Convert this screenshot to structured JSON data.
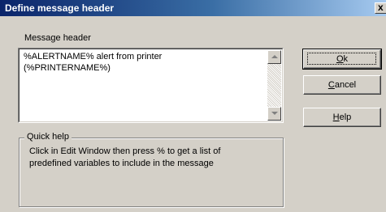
{
  "window": {
    "title": "Define message header",
    "close_glyph": "x"
  },
  "message_header": {
    "label": "Message header",
    "lines": [
      "%ALERTNAME% alert from printer",
      "(%PRINTERNAME%)"
    ]
  },
  "buttons": {
    "ok": {
      "prefix": "",
      "accel": "O",
      "rest": "k"
    },
    "cancel": {
      "prefix": "",
      "accel": "C",
      "rest": "ancel"
    },
    "help": {
      "prefix": "",
      "accel": "H",
      "rest": "elp"
    }
  },
  "quick_help": {
    "title": "Quick help",
    "lines": [
      "Click in Edit Window then press % to get a list of",
      "predefined variables to include in the message"
    ]
  },
  "icons": {
    "scroll_up": "scroll-up-arrow-icon",
    "scroll_down": "scroll-down-arrow-icon",
    "close": "close-icon"
  }
}
